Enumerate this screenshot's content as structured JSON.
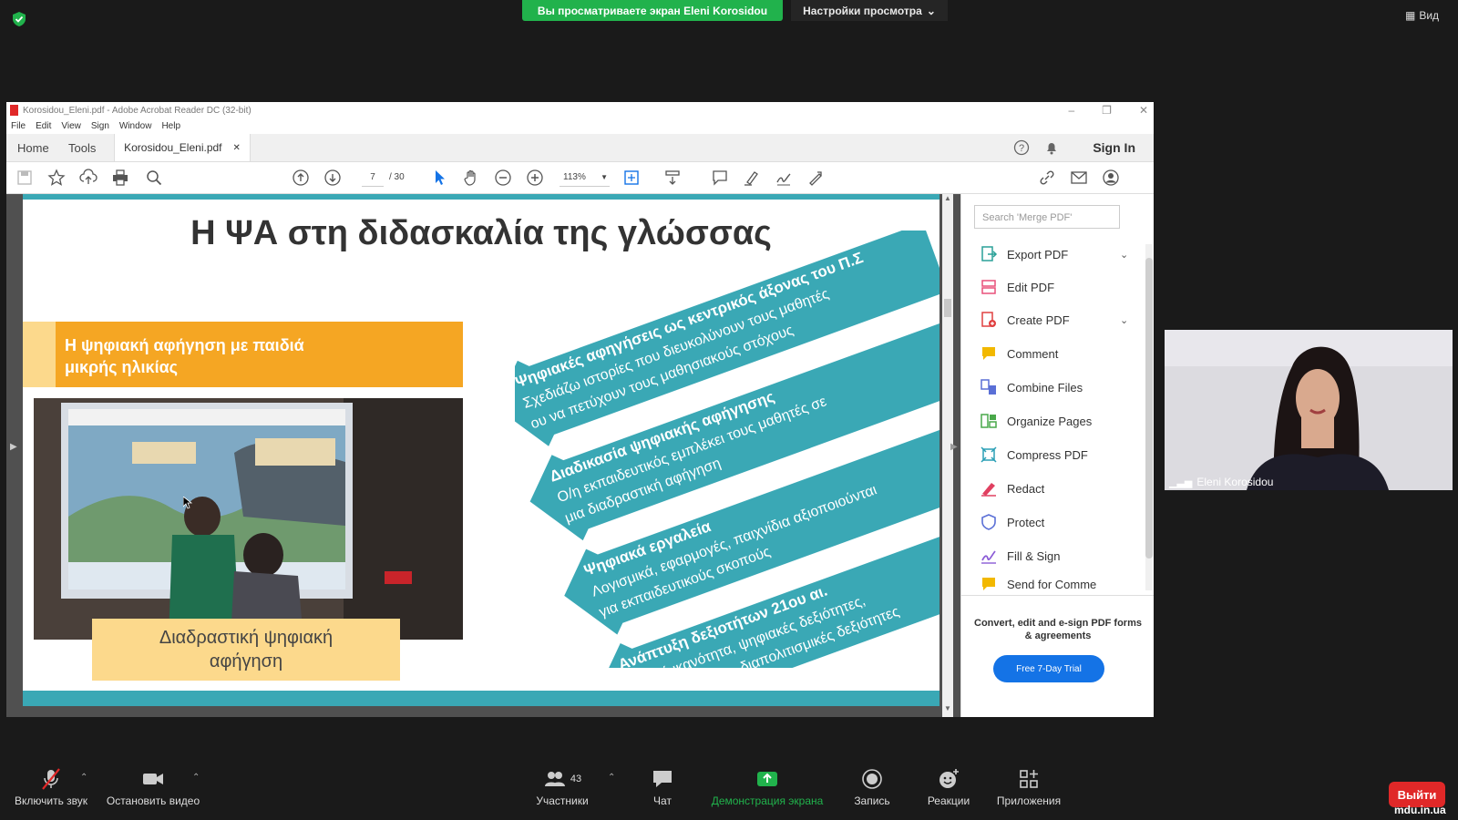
{
  "zoom": {
    "share_banner": "Вы просматриваете экран Eleni Korosidou",
    "view_settings": "Настройки просмотра",
    "view_button": "Вид",
    "participant_count": "43",
    "bottom": {
      "mute": "Включить звук",
      "video": "Остановить видео",
      "participants": "Участники",
      "chat": "Чат",
      "share": "Демонстрация экрана",
      "record": "Запись",
      "reactions": "Реакции",
      "apps": "Приложения",
      "exit": "Выйти"
    },
    "watermark": "mdu.in.ua",
    "speaker_name": "Eleni Korosidou",
    "colors": {
      "banner": "#21b24c",
      "exit": "#e02828"
    }
  },
  "acrobat": {
    "window_title": "Korosidou_Eleni.pdf - Adobe Acrobat Reader DC (32-bit)",
    "menu": [
      "File",
      "Edit",
      "View",
      "Sign",
      "Window",
      "Help"
    ],
    "tabs": {
      "home": "Home",
      "tools": "Tools",
      "document": "Korosidou_Eleni.pdf"
    },
    "sign_in": "Sign In",
    "page_current": "7",
    "page_total": "/ 30",
    "zoom": "113%",
    "search_placeholder": "Search 'Merge PDF'",
    "tools": [
      {
        "label": "Export PDF",
        "icon": "export-pdf-icon",
        "color": "#2aa198"
      },
      {
        "label": "Edit PDF",
        "icon": "edit-pdf-icon",
        "color": "#e8507a"
      },
      {
        "label": "Create PDF",
        "icon": "create-pdf-icon",
        "color": "#e04040"
      },
      {
        "label": "Comment",
        "icon": "comment-icon",
        "color": "#f2b800"
      },
      {
        "label": "Combine Files",
        "icon": "combine-files-icon",
        "color": "#5a6fd6"
      },
      {
        "label": "Organize Pages",
        "icon": "organize-pages-icon",
        "color": "#49a84a"
      },
      {
        "label": "Compress PDF",
        "icon": "compress-pdf-icon",
        "color": "#2a9fb6"
      },
      {
        "label": "Redact",
        "icon": "redact-icon",
        "color": "#e04060"
      },
      {
        "label": "Protect",
        "icon": "protect-icon",
        "color": "#5a6fd6"
      },
      {
        "label": "Fill & Sign",
        "icon": "fill-sign-icon",
        "color": "#8a5ad6"
      },
      {
        "label": "Send for Comme",
        "icon": "send-comment-icon",
        "color": "#f2b800"
      }
    ],
    "promo_text": "Convert, edit and e-sign PDF forms & agreements",
    "trial_button": "Free 7-Day Trial"
  },
  "slide": {
    "title": "Η ΨΑ στη διδασκαλία της γλώσσας",
    "orange_box": [
      "Η ψηφιακή αφήγηση με παιδιά",
      "μικρής ηλικίας"
    ],
    "caption": [
      "Διαδραστική ψηφιακή",
      "αφήγηση"
    ],
    "arrows": [
      {
        "heading": "Ψηφιακές αφηγήσεις ως κεντρικός άξονας του Π.Σ",
        "lines": [
          "Σχεδιάζω ιστορίες που διευκολύνουν τους μαθητές",
          "ου να πετύχουν τους μαθησιακούς στόχους"
        ]
      },
      {
        "heading": "Διαδικασία ψηφιακής αφήγησης",
        "lines": [
          "Ο/η εκπαιδευτικός εμπλέκει τους μαθητές σε",
          "μια διαδραστική αφήγηση"
        ]
      },
      {
        "heading": "Ψηφιακά εργαλεία",
        "lines": [
          "Λογισμικά, εφαρμογές, παιχνίδια αξιοποιούνται",
          "για εκπαιδευτικούς σκοπούς"
        ]
      },
      {
        "heading": "Ανάπτυξη δεξιοτήτων 21ου αι.",
        "lines": [
          "Κριτική ικανότητα, ψηφιακές δεξιότητες,",
          "δημιουργικότητα, διαπολιτισμικές δεξιότητες"
        ]
      }
    ],
    "colors": {
      "teal": "#3aa8b5",
      "orange": "#f5a623",
      "light_orange": "#fcd98c"
    }
  }
}
